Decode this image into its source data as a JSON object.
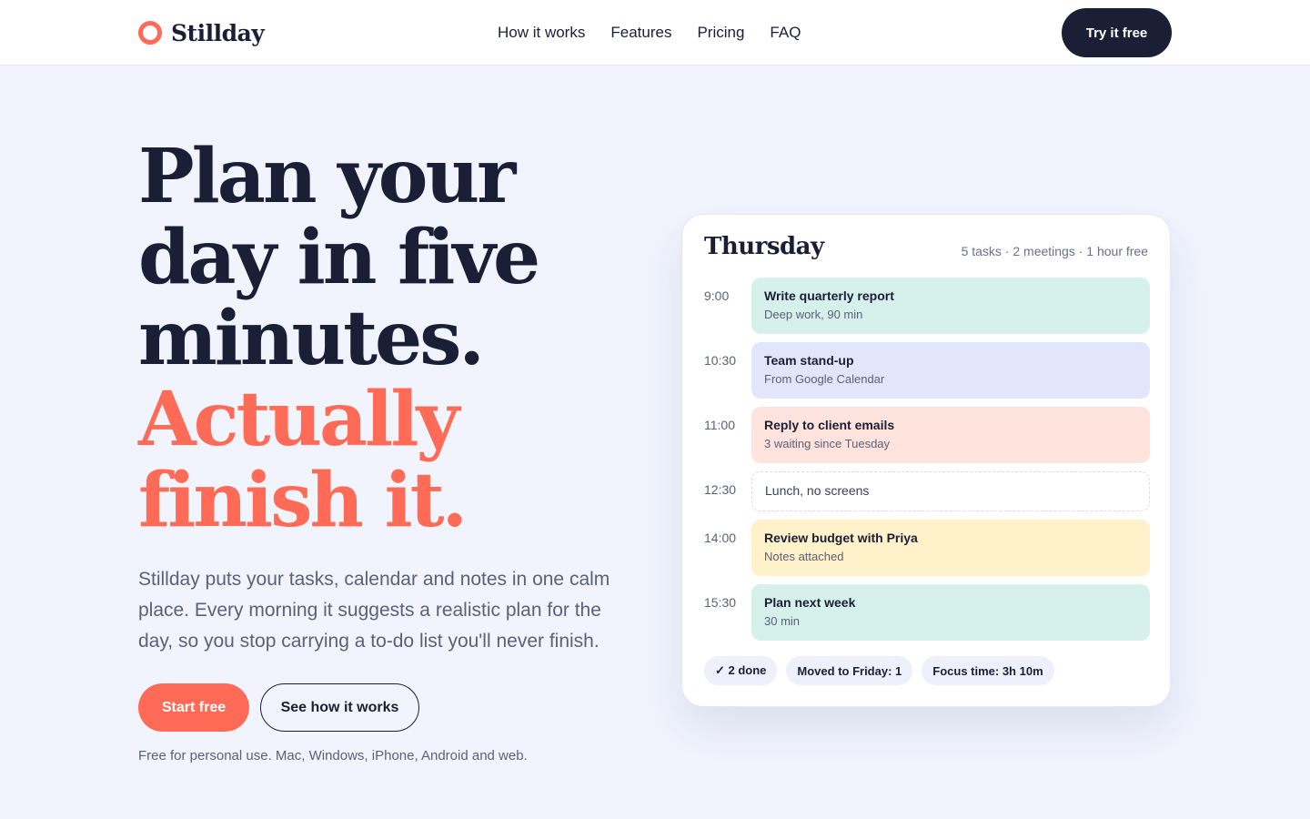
{
  "brand": {
    "name": "Stillday",
    "accent": "#ff6b57",
    "ink": "#1a1f36"
  },
  "nav": {
    "items": [
      "How it works",
      "Features",
      "Pricing",
      "FAQ"
    ],
    "cta": "Try it free"
  },
  "hero": {
    "headline_lines": [
      "Plan your",
      "day in five",
      "minutes."
    ],
    "headline_accent_lines": [
      "Actually",
      "finish it."
    ],
    "lede": "Stillday puts your tasks, calendar and notes in one calm place. Every morning it suggests a realistic plan for the day, so you stop carrying a to-do list you'll never finish.",
    "primary_cta": "Start free",
    "secondary_cta": "See how it works",
    "fineprint": "Free for personal use. Mac, Windows, iPhone, Android and web."
  },
  "planner": {
    "day": "Thursday",
    "summary": "5 tasks · 2 meetings · 1 hour free",
    "slots": [
      {
        "time": "9:00",
        "title": "Write quarterly report",
        "subtitle": "Deep work, 90 min",
        "color": "#d6f1ec"
      },
      {
        "time": "10:30",
        "title": "Team stand-up",
        "subtitle": "From Google Calendar",
        "color": "#e1e6fc"
      },
      {
        "time": "11:00",
        "title": "Reply to client emails",
        "subtitle": "3 waiting since Tuesday",
        "color": "#ffe3dc"
      },
      {
        "time": "12:30",
        "title": "Lunch, no screens",
        "subtitle": "",
        "color": "#ffffff"
      },
      {
        "time": "14:00",
        "title": "Review budget with Priya",
        "subtitle": "Notes attached",
        "color": "#fff1c9"
      },
      {
        "time": "15:30",
        "title": "Plan next week",
        "subtitle": "30 min",
        "color": "#d6f1ec"
      }
    ],
    "chips": [
      "✓ 2 done",
      "Moved to Friday: 1",
      "Focus time: 3h 10m"
    ]
  }
}
